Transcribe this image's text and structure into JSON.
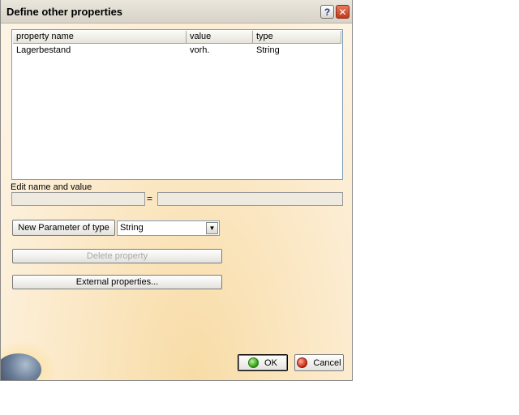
{
  "window": {
    "title": "Define other properties",
    "help_glyph": "?",
    "close_glyph": "✕"
  },
  "table": {
    "columns": [
      "property name",
      "value",
      "type"
    ],
    "rows": [
      {
        "name": "Lagerbestand",
        "value": "vorh.",
        "type": "String"
      }
    ]
  },
  "edit": {
    "label": "Edit name and value",
    "name_value": "",
    "value_value": "",
    "equals": "="
  },
  "new_param": {
    "button_label": "New Parameter of type",
    "selected_type": "String"
  },
  "buttons": {
    "delete": "Delete property",
    "external": "External properties...",
    "ok": "OK",
    "cancel": "Cancel"
  }
}
